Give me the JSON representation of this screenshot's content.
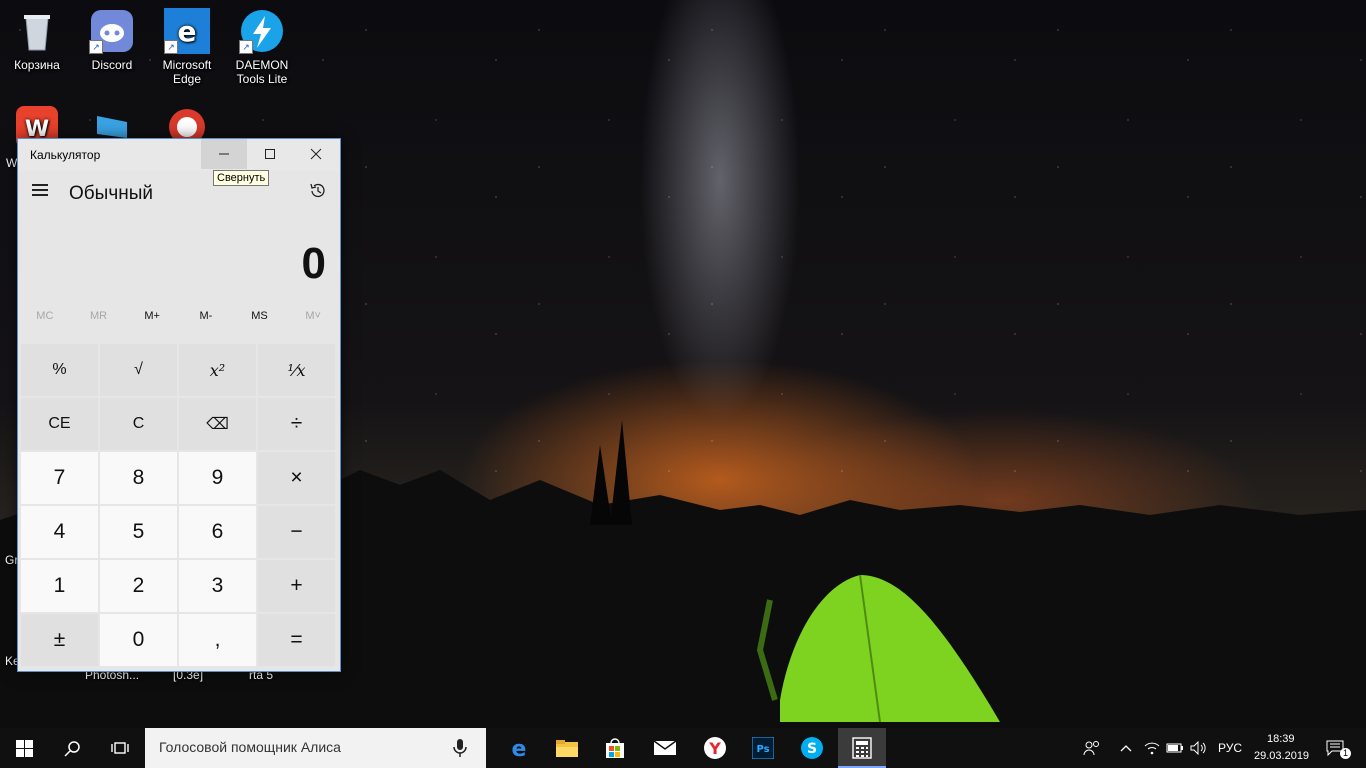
{
  "desktop_icons": [
    {
      "label": "Корзина",
      "icon": "recycle-bin-icon"
    },
    {
      "label": "Discord",
      "icon": "discord-icon"
    },
    {
      "label": "Microsoft Edge",
      "icon": "edge-icon"
    },
    {
      "label": "DAEMON Tools Lite",
      "icon": "daemon-tools-icon"
    },
    {
      "label": "",
      "icon": "wps-office-icon"
    },
    {
      "label": "",
      "icon": "monitor-icon"
    },
    {
      "label": "",
      "icon": "ccleaner-icon"
    }
  ],
  "partial_labels": {
    "w": "W",
    "gr": "Gr",
    "ke": "Ke",
    "photoshop": "Photosh...",
    "zero3e": "[0.3e]",
    "gta5": "rta 5"
  },
  "calculator": {
    "title": "Калькулятор",
    "tooltip": "Свернуть",
    "mode": "Обычный",
    "display": "0",
    "memory": [
      {
        "label": "MC",
        "enabled": false
      },
      {
        "label": "MR",
        "enabled": false
      },
      {
        "label": "M+",
        "enabled": true
      },
      {
        "label": "M-",
        "enabled": true
      },
      {
        "label": "MS",
        "enabled": true
      },
      {
        "label": "M˅",
        "enabled": false
      }
    ],
    "keys": {
      "percent": "%",
      "sqrt": "√",
      "square": "x²",
      "reciprocal": "¹⁄x",
      "ce": "CE",
      "c": "C",
      "backspace": "⌫",
      "divide": "÷",
      "seven": "7",
      "eight": "8",
      "nine": "9",
      "multiply": "×",
      "four": "4",
      "five": "5",
      "six": "6",
      "minus": "−",
      "one": "1",
      "two": "2",
      "three": "3",
      "plus": "+",
      "negate": "±",
      "zero": "0",
      "decimal": ",",
      "equals": "="
    }
  },
  "taskbar": {
    "search_placeholder": "Голосовой помощник Алиса",
    "language": "РУС",
    "time": "18:39",
    "date": "29.03.2019",
    "notification_count": "1",
    "apps": [
      "edge-icon",
      "file-explorer-icon",
      "store-icon",
      "mail-icon",
      "yandex-browser-icon",
      "photoshop-icon",
      "skype-icon",
      "calculator-icon"
    ]
  },
  "colors": {
    "accent": "#7aa7ff",
    "window_border": "#5b8fc9",
    "tent_green": "#7ed321"
  }
}
